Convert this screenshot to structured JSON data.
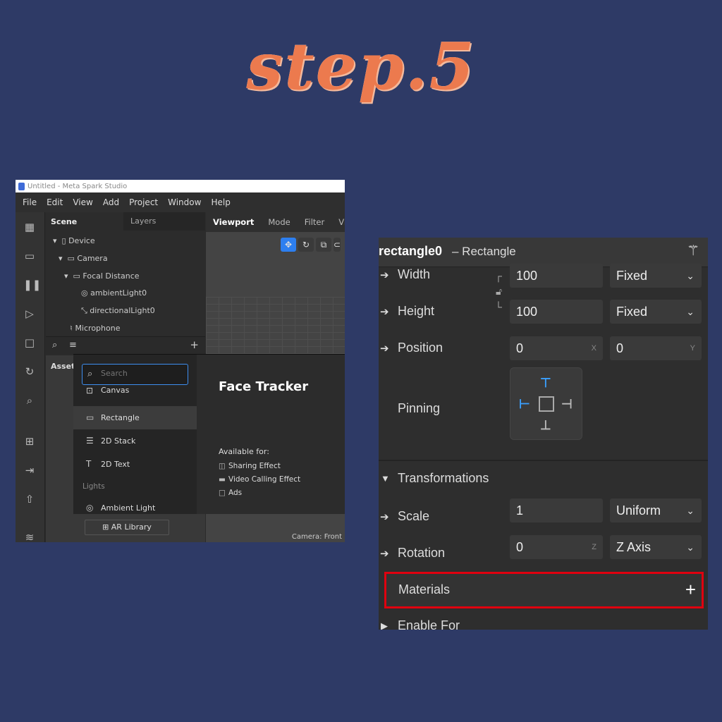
{
  "headline": "step.5",
  "left_screenshot": {
    "window_title": "Untitled - Meta Spark Studio",
    "menu": [
      "File",
      "Edit",
      "View",
      "Add",
      "Project",
      "Window",
      "Help"
    ],
    "scene_tabs": [
      "Scene",
      "Layers"
    ],
    "scene_tree": [
      "Device",
      "Camera",
      "Focal Distance",
      "ambientLight0",
      "directionalLight0",
      "Microphone"
    ],
    "assets_label": "Assets",
    "ar_library": "AR Library",
    "viewport_tabs": [
      "Viewport",
      "Mode",
      "Filter",
      "Vie"
    ],
    "camera_label": "Camera: Front",
    "popup": {
      "search_placeholder": "Search",
      "items": [
        "Canvas",
        "Rectangle",
        "2D Stack",
        "2D Text"
      ],
      "category": "Lights",
      "last_item": "Ambient Light",
      "detail_title": "Face Tracker",
      "available_label": "Available for:",
      "available": [
        "Sharing Effect",
        "Video Calling Effect",
        "Ads"
      ]
    }
  },
  "inspector": {
    "object_name": "rectangle0",
    "object_type": "– Rectangle",
    "width_label": "Width",
    "width_value": "100",
    "width_mode": "Fixed",
    "height_label": "Height",
    "height_value": "100",
    "height_mode": "Fixed",
    "position_label": "Position",
    "position_x": "0",
    "position_y": "0",
    "axis_x": "X",
    "axis_y": "Y",
    "pinning_label": "Pinning",
    "transformations_label": "Transformations",
    "scale_label": "Scale",
    "scale_value": "1",
    "scale_mode": "Uniform",
    "rotation_label": "Rotation",
    "rotation_value": "0",
    "axis_z": "Z",
    "rotation_mode": "Z Axis",
    "materials_label": "Materials",
    "enable_for_label": "Enable For",
    "highlight_color": "#e0000f"
  }
}
